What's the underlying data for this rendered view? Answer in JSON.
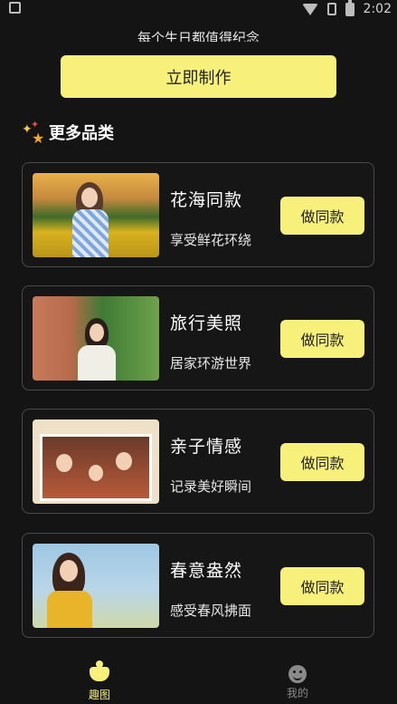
{
  "status_bar": {
    "time": "2:02"
  },
  "header": {
    "subtitle": "每个生日都值得纪念",
    "make_button": "立即制作"
  },
  "section": {
    "title": "更多品类"
  },
  "cards": [
    {
      "title": "花海同款",
      "desc": "享受鲜花环绕",
      "button": "做同款"
    },
    {
      "title": "旅行美照",
      "desc": "居家环游世界",
      "button": "做同款"
    },
    {
      "title": "亲子情感",
      "desc": "记录美好瞬间",
      "button": "做同款"
    },
    {
      "title": "春意盎然",
      "desc": "感受春风拂面",
      "button": "做同款"
    }
  ],
  "bottom_nav": {
    "items": [
      {
        "label": "趣图",
        "active": true
      },
      {
        "label": "我的",
        "active": false
      }
    ]
  },
  "colors": {
    "accent": "#f7f07a",
    "background": "#141414",
    "card_border": "#4a4a4a"
  }
}
